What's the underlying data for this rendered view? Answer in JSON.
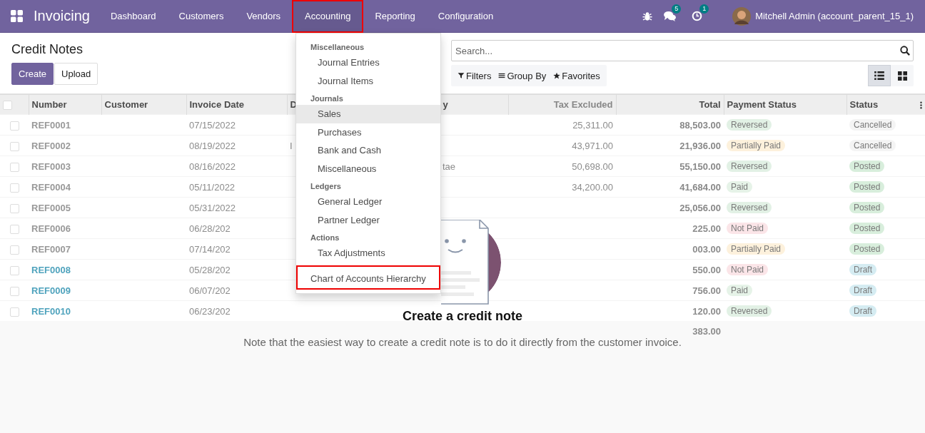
{
  "navbar": {
    "app_name": "Invoicing",
    "menu": [
      {
        "label": "Dashboard",
        "selected": false,
        "annotated": false
      },
      {
        "label": "Customers",
        "selected": false,
        "annotated": false
      },
      {
        "label": "Vendors",
        "selected": false,
        "annotated": false
      },
      {
        "label": "Accounting",
        "selected": true,
        "annotated": true
      },
      {
        "label": "Reporting",
        "selected": false,
        "annotated": false
      },
      {
        "label": "Configuration",
        "selected": false,
        "annotated": false
      }
    ],
    "messages_badge": "5",
    "activities_badge": "1",
    "user_name": "Mitchell Admin (account_parent_15_1)"
  },
  "dropdown": [
    {
      "kind": "header",
      "label": "Miscellaneous"
    },
    {
      "kind": "item",
      "label": "Journal Entries",
      "active": false,
      "annotated": false
    },
    {
      "kind": "item",
      "label": "Journal Items",
      "active": false,
      "annotated": false
    },
    {
      "kind": "header",
      "label": "Journals"
    },
    {
      "kind": "item",
      "label": "Sales",
      "active": true,
      "annotated": false
    },
    {
      "kind": "item",
      "label": "Purchases",
      "active": false,
      "annotated": false
    },
    {
      "kind": "item",
      "label": "Bank and Cash",
      "active": false,
      "annotated": false
    },
    {
      "kind": "item",
      "label": "Miscellaneous",
      "active": false,
      "annotated": false
    },
    {
      "kind": "header",
      "label": "Ledgers"
    },
    {
      "kind": "item",
      "label": "General Ledger",
      "active": false,
      "annotated": false
    },
    {
      "kind": "item",
      "label": "Partner Ledger",
      "active": false,
      "annotated": false
    },
    {
      "kind": "header",
      "label": "Actions"
    },
    {
      "kind": "item",
      "label": "Tax Adjustments",
      "active": false,
      "annotated": false
    },
    {
      "kind": "top",
      "label": "Chart of Accounts Hierarchy",
      "active": false,
      "annotated": true
    }
  ],
  "control_panel": {
    "title": "Credit Notes",
    "buttons": [
      "Create",
      "Upload"
    ],
    "search": {
      "placeholder": "Search..."
    },
    "filters": [
      "Filters",
      "Group By",
      "Favorites"
    ],
    "views": [
      {
        "kind": "list",
        "selected": true
      },
      {
        "kind": "kanban",
        "selected": false
      }
    ]
  },
  "table": {
    "header_checked": false,
    "columns": [
      "Number",
      "Customer",
      "Invoice Date",
      "D",
      "y",
      "Tax Excluded",
      "Total",
      "Payment Status",
      "Status"
    ],
    "rows": [
      {
        "checked": false,
        "draft": false,
        "number": "REF0001",
        "date": "07/15/2022",
        "column_4": "",
        "column_5": "",
        "tax_excluded": "25,311.00",
        "total": "88,503.00",
        "payment_status": {
          "text": "Reversed",
          "color": "#e2f1e5"
        },
        "status": {
          "text": "Cancelled",
          "color": "#f4f4f4"
        }
      },
      {
        "checked": false,
        "draft": false,
        "number": "REF0002",
        "date": "08/19/2022",
        "column_4": "I",
        "column_5": "",
        "tax_excluded": "43,971.00",
        "total": "21,936.00",
        "payment_status": {
          "text": "Partially Paid",
          "color": "#fdf1dc"
        },
        "status": {
          "text": "Cancelled",
          "color": "#f4f4f4"
        }
      },
      {
        "checked": false,
        "draft": false,
        "number": "REF0003",
        "date": "08/16/2022",
        "column_4": "",
        "column_5": "tae",
        "tax_excluded": "50,698.00",
        "total": "55,150.00",
        "payment_status": {
          "text": "Reversed",
          "color": "#e2f1e5"
        },
        "status": {
          "text": "Posted",
          "color": "#d8eedc"
        }
      },
      {
        "checked": false,
        "draft": false,
        "number": "REF0004",
        "date": "05/11/2022",
        "column_4": "",
        "column_5": "",
        "tax_excluded": "34,200.00",
        "total": "41,684.00",
        "payment_status": {
          "text": "Paid",
          "color": "#e6f3e8"
        },
        "status": {
          "text": "Posted",
          "color": "#d8eedc"
        }
      },
      {
        "checked": false,
        "draft": false,
        "number": "REF0005",
        "date": "05/31/2022",
        "column_4": "",
        "column_5": "",
        "tax_excluded": "",
        "total": "25,056.00",
        "payment_status": {
          "text": "Reversed",
          "color": "#e2f1e5"
        },
        "status": {
          "text": "Posted",
          "color": "#d8eedc"
        }
      },
      {
        "checked": false,
        "draft": false,
        "number": "REF0006",
        "date": "06/28/202",
        "column_4": "",
        "column_5": "",
        "tax_excluded": "",
        "total": "225.00",
        "payment_status": {
          "text": "Not Paid",
          "color": "#fbe5e8"
        },
        "status": {
          "text": "Posted",
          "color": "#d8eedc"
        }
      },
      {
        "checked": false,
        "draft": false,
        "number": "REF0007",
        "date": "07/14/202",
        "column_4": "",
        "column_5": "",
        "tax_excluded": "",
        "total": "003.00",
        "payment_status": {
          "text": "Partially Paid",
          "color": "#fdf1dc"
        },
        "status": {
          "text": "Posted",
          "color": "#d8eedc"
        }
      },
      {
        "checked": false,
        "draft": true,
        "number": "REF0008",
        "date": "05/28/202",
        "column_4": "",
        "column_5": "",
        "tax_excluded": "",
        "total": "550.00",
        "payment_status": {
          "text": "Not Paid",
          "color": "#fbe5e8"
        },
        "status": {
          "text": "Draft",
          "color": "#d5ecf2"
        }
      },
      {
        "checked": false,
        "draft": true,
        "number": "REF0009",
        "date": "06/07/202",
        "column_4": "",
        "column_5": "",
        "tax_excluded": "",
        "total": "756.00",
        "payment_status": {
          "text": "Paid",
          "color": "#e6f3e8"
        },
        "status": {
          "text": "Draft",
          "color": "#d5ecf2"
        }
      },
      {
        "checked": false,
        "draft": true,
        "number": "REF0010",
        "date": "06/23/202",
        "column_4": "",
        "column_5": "",
        "tax_excluded": "",
        "total": "120.00",
        "payment_status": {
          "text": "Reversed",
          "color": "#e2f1e5"
        },
        "status": {
          "text": "Draft",
          "color": "#d5ecf2"
        }
      }
    ],
    "footer_total": "383.00"
  },
  "empty_state": {
    "title": "Create a credit note",
    "text": "Note that the easiest way to create a credit note is to do it directly from the customer invoice."
  }
}
